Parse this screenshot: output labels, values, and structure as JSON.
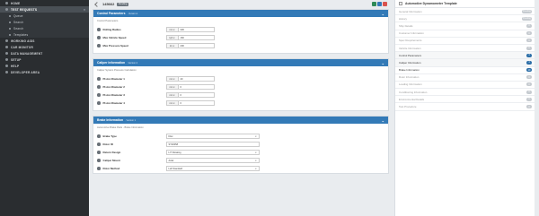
{
  "sidebar": {
    "items": [
      {
        "label": "HOME",
        "type": "top",
        "active": false
      },
      {
        "label": "TEST REQUESTS",
        "type": "top",
        "active": true
      },
      {
        "label": "Queue",
        "type": "sub"
      },
      {
        "label": "Search",
        "type": "sub"
      },
      {
        "label": "Search",
        "type": "sub"
      },
      {
        "label": "Templates",
        "type": "sub"
      },
      {
        "label": "WORKING AIDS",
        "type": "top"
      },
      {
        "label": "CAR MONITOR",
        "type": "top"
      },
      {
        "label": "DATA MANAGEMENT",
        "type": "top"
      },
      {
        "label": "SETUP",
        "type": "top"
      },
      {
        "label": "HELP",
        "type": "top"
      },
      {
        "label": "DEVELOPER AREA",
        "type": "top"
      }
    ]
  },
  "topbar": {
    "title": "145662",
    "status_badge": "Pending",
    "action_colors": [
      "#2e8b57",
      "#337ab7",
      "#d9534f"
    ]
  },
  "cards": {
    "control": {
      "title": "Control Parameters",
      "subtitle": "· Version 1",
      "description": "Control Parameters",
      "rows": [
        {
          "label": "Rolling Radius",
          "unit": "mm ▾",
          "value": "330"
        },
        {
          "label": "Max Vehicle Speed",
          "unit": "kph ▾",
          "value": "160"
        },
        {
          "label": "Max Pressure Speed",
          "unit": "km ▾",
          "value": "200"
        }
      ]
    },
    "caliper": {
      "title": "Caliper Information",
      "subtitle": "· Version 2",
      "description": "Caliper System Pressure Calculation",
      "rows": [
        {
          "label": "Piston Diameter 1",
          "unit": "mm ▾",
          "value": "40"
        },
        {
          "label": "Piston Diameter 2",
          "unit": "mm ▾",
          "value": "0"
        },
        {
          "label": "Piston Diameter 3",
          "unit": "mm ▾",
          "value": "0"
        },
        {
          "label": "Piston Diameter 4",
          "unit": "mm ▾",
          "value": "0"
        }
      ]
    },
    "brake": {
      "title": "Brake Information",
      "subtitle": "· Version 1",
      "description": "Automotive Brake Pads - Brake Information",
      "rows": [
        {
          "label": "Brake Type",
          "kind": "select",
          "value": "Disc"
        },
        {
          "label": "Rotor ID",
          "kind": "text",
          "value": "ST20058"
        },
        {
          "label": "Return Design",
          "kind": "select",
          "value": "L/T Rotating"
        },
        {
          "label": "Caliper Mount",
          "kind": "select",
          "value": "Axial"
        },
        {
          "label": "Rotor Method",
          "kind": "select",
          "value": "Left Standard"
        }
      ]
    }
  },
  "template_panel": {
    "title": "Automotive Dynamometer Template",
    "items": [
      {
        "label": "General Information",
        "count": "Pending",
        "state": "pending",
        "wide": true
      },
      {
        "label": "History",
        "count": "Pending",
        "state": "pending",
        "wide": true
      },
      {
        "label": "Ship Details",
        "count": "0",
        "state": "pending"
      },
      {
        "label": "Customer Information",
        "count": "0",
        "state": "pending"
      },
      {
        "label": "Spec Requirements",
        "count": "0",
        "state": "pending"
      },
      {
        "label": "Vehicle Information",
        "count": "0",
        "state": "pending"
      },
      {
        "label": "Control Parameters",
        "count": "3",
        "state": "done"
      },
      {
        "label": "Caliper Information",
        "count": "4",
        "state": "done"
      },
      {
        "label": "Brake Information",
        "count": "10",
        "state": "current"
      },
      {
        "label": "Rotor Information",
        "count": "0",
        "state": "pending"
      },
      {
        "label": "Loading Information",
        "count": "0",
        "state": "pending"
      },
      {
        "label": "Conditioning Information",
        "count": "0",
        "state": "pending"
      },
      {
        "label": "Environmental Details",
        "count": "0",
        "state": "pending"
      },
      {
        "label": "Test Procedure",
        "count": "0",
        "state": "pending"
      }
    ]
  }
}
